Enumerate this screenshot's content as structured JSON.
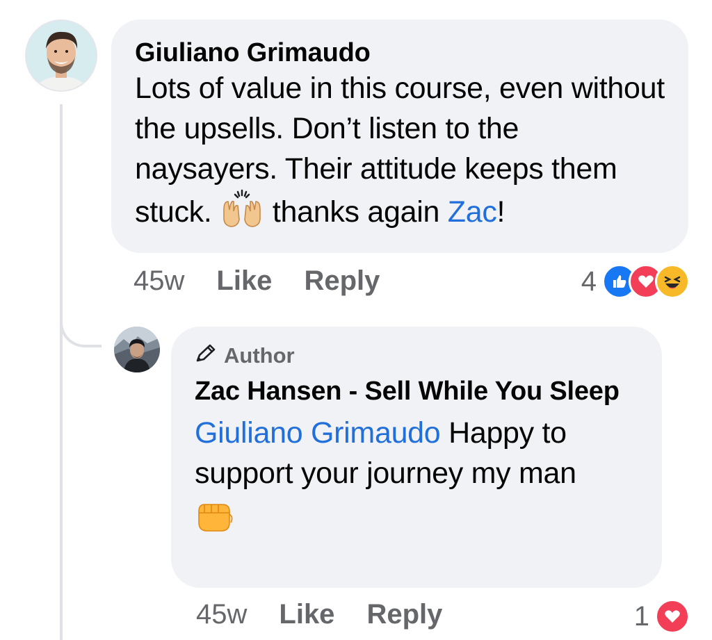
{
  "comment": {
    "author": "Giuliano Grimaudo",
    "text_before_emoji": "Lots of value in this course, even without the upsells. Don’t listen to the naysayers. Their attitude keeps them stuck.",
    "text_after_emoji": "thanks again",
    "mention": "Zac",
    "text_end": "!",
    "emoji_icon": "raising-hands-emoji",
    "time": "45w",
    "like_label": "Like",
    "reply_label": "Reply",
    "reaction_count": "4",
    "reactions": [
      "like-reaction-icon",
      "love-reaction-icon",
      "haha-reaction-icon"
    ]
  },
  "reply": {
    "badge_label": "Author",
    "author": "Zac Hansen - Sell While You Sleep",
    "mention": "Giuliano Grimaudo",
    "text": "Happy to support your journey my man",
    "emoji_icon": "fist-bump-emoji",
    "time": "45w",
    "like_label": "Like",
    "reply_label": "Reply",
    "reaction_count": "1",
    "reactions": [
      "love-reaction-icon"
    ]
  },
  "colors": {
    "bubble": "#f0f2f5",
    "mention": "#216fdb",
    "secondary_text": "#65676b",
    "like_blue": "#1877f2",
    "love_red": "#f33e58",
    "haha_yellow": "#f7b928"
  }
}
